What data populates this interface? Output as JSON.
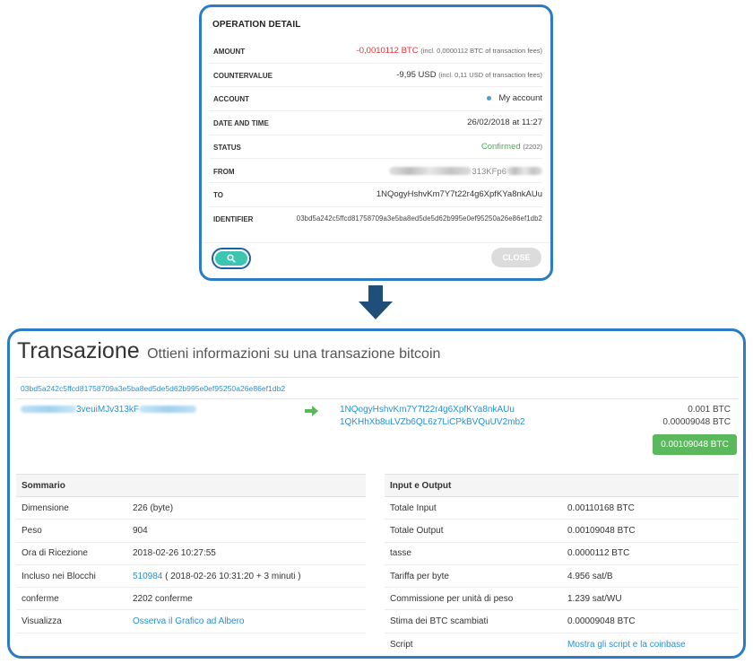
{
  "modal": {
    "title": "OPERATION DETAIL",
    "rows": {
      "amount": {
        "label": "AMOUNT",
        "value": "-0,0010112 BTC",
        "note": "(incl. 0,0000112 BTC of transaction fees)"
      },
      "countervalue": {
        "label": "COUNTERVALUE",
        "value": "-9,95 USD",
        "note": "(incl. 0,11 USD of transaction fees)"
      },
      "account": {
        "label": "ACCOUNT",
        "value": "My account"
      },
      "datetime": {
        "label": "DATE AND TIME",
        "value": "26/02/2018 at 11:27"
      },
      "status": {
        "label": "STATUS",
        "value": "Confirmed",
        "note": "(2202)"
      },
      "from": {
        "label": "FROM",
        "value": "313KFp6"
      },
      "to": {
        "label": "TO",
        "value": "1NQogyHshvKm7Y7t22r4g6XpfKYa8nkAUu"
      },
      "identifier": {
        "label": "IDENTIFIER",
        "value": "03bd5a242c5ffcd81758709a3e5ba8ed5de5d62b995e0ef95250a26e86ef1db2"
      }
    },
    "close_label": "CLOSE",
    "colors": {
      "accent": "#3cc5b1",
      "negative": "#e0323c",
      "confirmed": "#4cae4c",
      "highlight": "#2b7cc4"
    }
  },
  "page": {
    "title": "Transazione",
    "subtitle": "Ottieni informazioni su una transazione bitcoin",
    "txid": "03bd5a242c5ffcd81758709a3e5ba8ed5de5d62b995e0ef95250a26e86ef1db2",
    "from_address": "3veuiMJv313kF",
    "outputs": [
      {
        "address": "1NQogyHshvKm7Y7t22r4g6XpfKYa8nkAUu",
        "amount": "0.001 BTC"
      },
      {
        "address": "1QKHhXb8uLVZb6QL6z7LiCPkBVQuUV2mb2",
        "amount": "0.00009048 BTC"
      }
    ],
    "total": "0.00109048 BTC",
    "summary": {
      "heading": "Sommario",
      "rows": [
        {
          "key": "Dimensione",
          "value": "226 (byte)"
        },
        {
          "key": "Peso",
          "value": "904"
        },
        {
          "key": "Ora di Ricezione",
          "value": "2018-02-26 10:27:55"
        },
        {
          "key": "Incluso nei Blocchi",
          "block": "510984",
          "value": "( 2018-02-26 10:31:20 + 3 minuti )"
        },
        {
          "key": "conferme",
          "value": "2202 conferme"
        },
        {
          "key": "Visualizza",
          "value": "Osserva il Grafico ad Albero"
        }
      ]
    },
    "io": {
      "heading": "Input e Output",
      "rows": [
        {
          "key": "Totale Input",
          "value": "0.00110168 BTC"
        },
        {
          "key": "Totale Output",
          "value": "0.00109048 BTC"
        },
        {
          "key": "tasse",
          "value": "0.0000112 BTC"
        },
        {
          "key": "Tariffa per byte",
          "value": "4.956 sat/B"
        },
        {
          "key": "Commissione per unità di peso",
          "value": "1.239 sat/WU"
        },
        {
          "key": "Stima dei BTC scambiati",
          "value": "0.00009048 BTC"
        },
        {
          "key": "Script",
          "value": "Mostra gli script e la coinbase"
        }
      ]
    },
    "icons": {
      "search": "search-icon",
      "arrow_down": "arrow-down-icon",
      "arrow_right": "arrow-right-icon"
    }
  }
}
